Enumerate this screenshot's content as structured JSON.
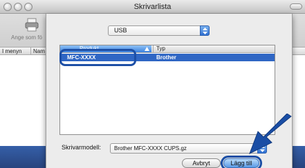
{
  "window": {
    "title": "Skrivarlista"
  },
  "toolbar": {
    "default_label": "Ange som fö"
  },
  "list_header": {
    "col_menu": "I menyn",
    "col_name": "Nam"
  },
  "sheet": {
    "connection_select": "USB",
    "browser": {
      "col_name": "Produkt",
      "col_type": "Typ",
      "rows": [
        {
          "name": "MFC-XXXX",
          "type": "Brother"
        }
      ]
    },
    "model_label": "Skrivarmodell:",
    "model_select": "Brother MFC-XXXX CUPS.gz",
    "cancel_label": "Avbryt",
    "add_label": "Lägg till"
  },
  "colors": {
    "selection": "#2f66c4",
    "callout": "#1d4fa6",
    "accent": "#3b81de"
  }
}
